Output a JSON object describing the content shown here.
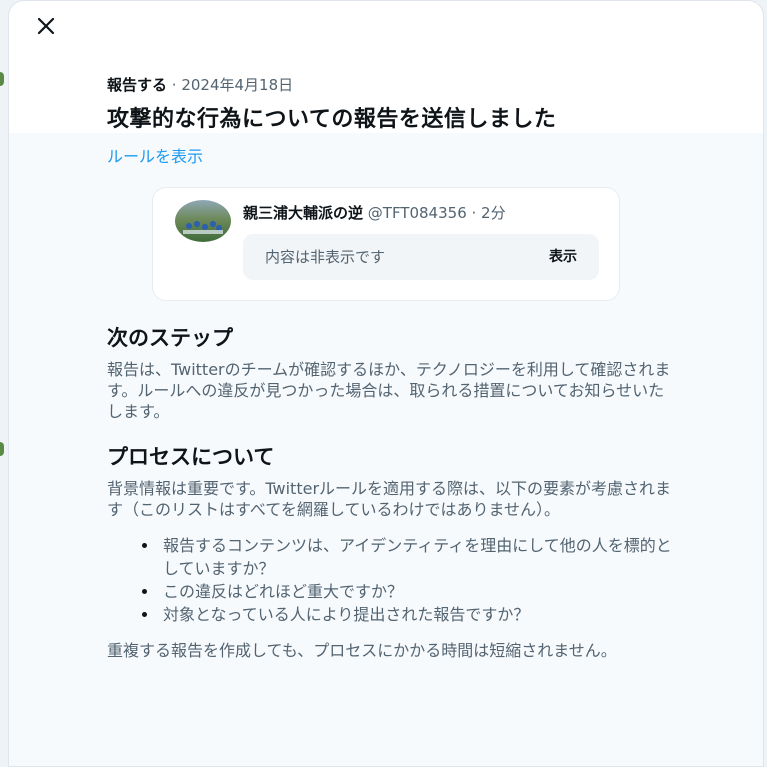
{
  "dialog": {
    "close_icon": "close-icon",
    "meta_type": "報告する",
    "meta_date": " · 2024年4月18日",
    "title": "攻撃的な行為についての報告を送信しました",
    "rules_link": "ルールを表示"
  },
  "tweet": {
    "author_name": "親三浦大輔派の逆",
    "handle_time": " @TFT084356 · 2分",
    "hidden_label": "内容は非表示です",
    "show_button": "表示"
  },
  "next_steps": {
    "heading": "次のステップ",
    "body": "報告は、Twitterのチームが確認するほか、テクノロジーを利用して確認されます。ルールへの違反が見つかった場合は、取られる措置についてお知らせいたします。"
  },
  "process": {
    "heading": "プロセスについて",
    "body": "背景情報は重要です。Twitterルールを適用する際は、以下の要素が考慮されます（このリストはすべてを網羅しているわけではありません）。",
    "items": [
      "報告するコンテンツは、アイデンティティを理由にして他の人を標的としていますか？",
      "この違反はどれほど重大ですか？",
      "対象となっている人により提出された報告ですか？"
    ],
    "footer": "重複する報告を作成しても、プロセスにかかる時間は短縮されません。"
  },
  "colors": {
    "link": "#1d9bf0",
    "text_primary": "#0f1419",
    "text_secondary": "#536471"
  }
}
